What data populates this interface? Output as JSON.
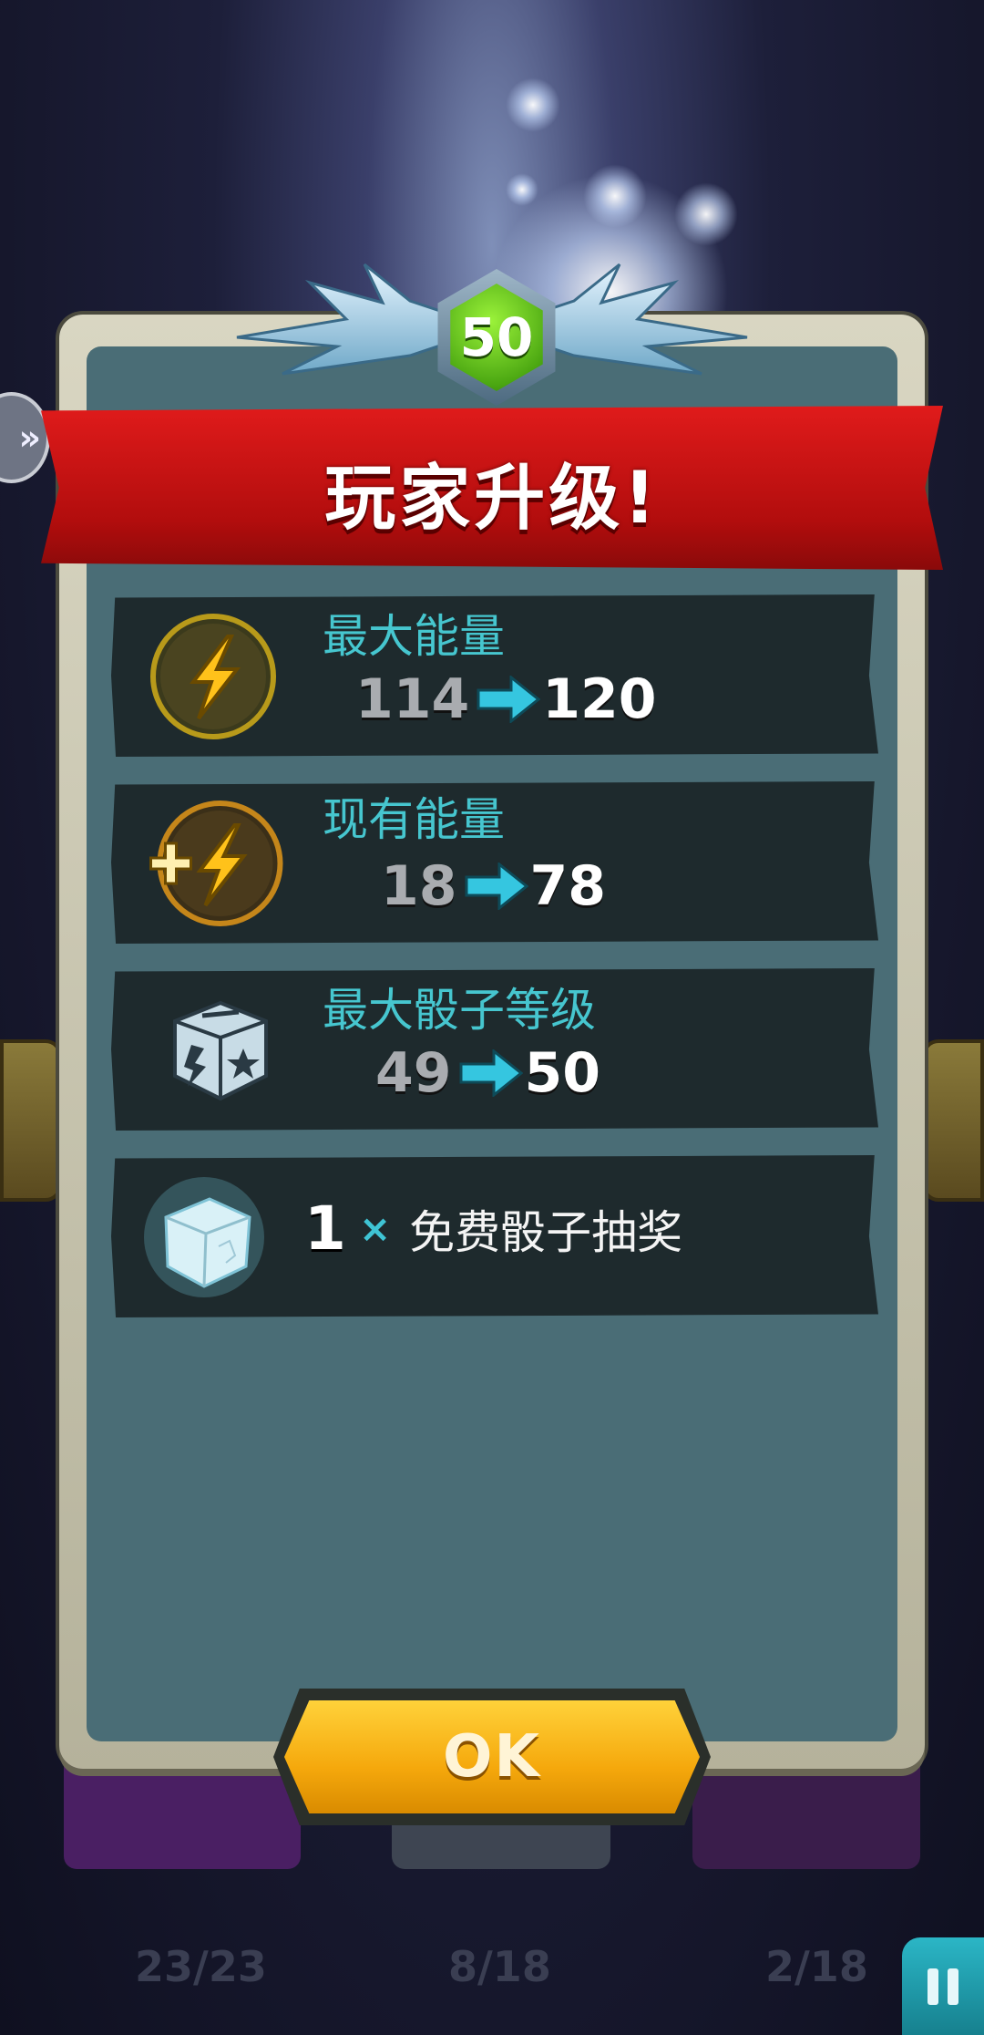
{
  "dialog": {
    "title": "玩家升级!",
    "level_badge": "50",
    "ok_label": "OK"
  },
  "stats": [
    {
      "label": "最大能量",
      "old_value": "114",
      "new_value": "120",
      "icon": "lightning-icon"
    },
    {
      "label": "现有能量",
      "old_value": "18",
      "new_value": "78",
      "icon": "plus-lightning-icon"
    },
    {
      "label": "最大骰子等级",
      "old_value": "49",
      "new_value": "50",
      "icon": "dice-icon"
    }
  ],
  "reward": {
    "count": "1",
    "multiplier": "×",
    "label": "免费骰子抽奖",
    "icon": "crystal-dice-icon"
  },
  "background": {
    "counters": [
      "23/23",
      "8/18",
      "2/18"
    ]
  },
  "colors": {
    "banner": "#d01414",
    "panel": "#4a6d76",
    "label": "#46c6cf",
    "ok_button": "#f5b412"
  }
}
